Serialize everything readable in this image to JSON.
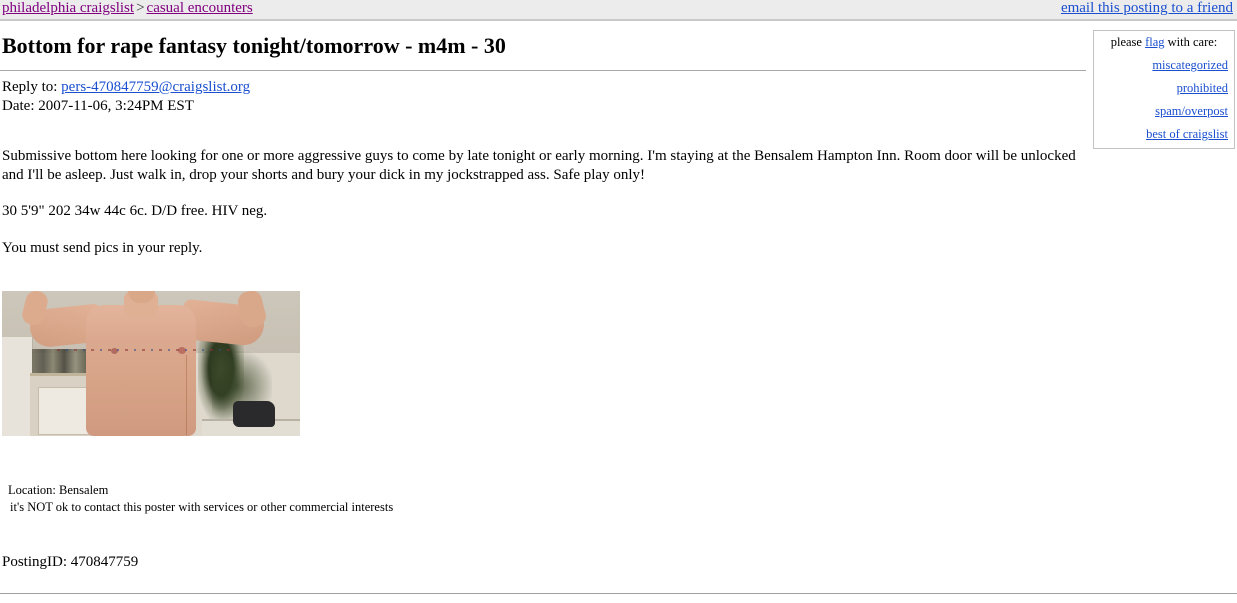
{
  "topbar": {
    "breadcrumb": {
      "site_label": "philadelphia craigslist",
      "separator": ">",
      "category_label": "casual encounters"
    },
    "email_friend_label": "email this posting to a friend"
  },
  "flagbox": {
    "heading_before": "please ",
    "heading_link": "flag",
    "heading_after": " with care:",
    "links": [
      {
        "label": "miscategorized"
      },
      {
        "label": "prohibited"
      },
      {
        "label": "spam/overpost"
      },
      {
        "label": "best of craigslist"
      }
    ]
  },
  "posting": {
    "title": "Bottom for rape fantasy tonight/tomorrow - m4m - 30",
    "reply_label": "Reply to:",
    "reply_email": "pers-470847759@craigslist.org",
    "date_line": "Date: 2007-11-06, 3:24PM EST",
    "body_paragraph_1": "Submissive bottom here looking for one or more aggressive guys to come by late tonight or early morning. I'm staying at the Bensalem Hampton Inn. Room door will be unlocked and I'll be asleep. Just walk in, drop your shorts and bury your dick in my jockstrapped ass. Safe play only!",
    "body_paragraph_2": "30 5'9\" 202 34w 44c 6c. D/D free. HIV neg.",
    "body_paragraph_3": "You must send pics in your reply.",
    "photo_alt": "posting photo of shirtless man flexing in a kitchen",
    "location_line": "Location: Bensalem",
    "no_contact_line": "it's NOT ok to contact this poster with services or other commercial interests",
    "posting_id_line": "PostingID: 470847759"
  },
  "colors": {
    "topbar_background": "#ececec",
    "breadcrumb_link": "#800080",
    "standard_link": "#1a4fcf",
    "rule": "#a8a8a8",
    "flagbox_border": "#c2c2c2"
  }
}
